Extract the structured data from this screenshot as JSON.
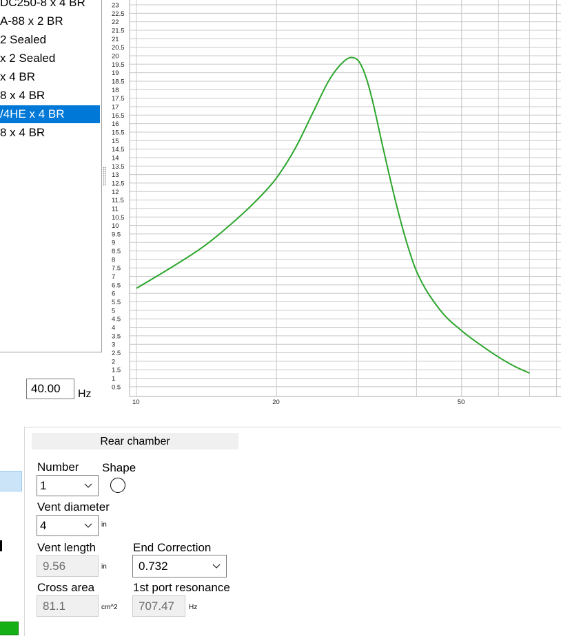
{
  "designs": {
    "items": [
      {
        "label": "DC250-8 x 4 BR",
        "selected": false
      },
      {
        "label": "A-88 x 2 BR",
        "selected": false
      },
      {
        "label": "2 Sealed",
        "selected": false
      },
      {
        "label": "x 2 Sealed",
        "selected": false
      },
      {
        "label": "x 4 BR",
        "selected": false
      },
      {
        "label": "8 x 4 BR",
        "selected": false
      },
      {
        "label": "/4HE x 4 BR",
        "selected": true
      },
      {
        "label": "8 x 4 BR",
        "selected": false
      }
    ]
  },
  "frequency": {
    "value": "40.00",
    "unit": "Hz"
  },
  "rear_chamber": {
    "title": "Rear chamber",
    "number_label": "Number",
    "number_value": "1",
    "shape_label": "Shape",
    "shape_icon": "circle-icon",
    "vent_diameter_label": "Vent diameter",
    "vent_diameter_value": "4",
    "vent_diameter_unit": "in",
    "vent_length_label": "Vent length",
    "vent_length_value": "9.56",
    "vent_length_unit": "in",
    "end_correction_label": "End Correction",
    "end_correction_value": "0.732",
    "cross_area_label": "Cross area",
    "cross_area_value": "81.1",
    "cross_area_unit": "cm^2",
    "port_resonance_label": "1st port resonance",
    "port_resonance_value": "707.47",
    "port_resonance_unit": "Hz"
  },
  "chart_data": {
    "type": "line",
    "x_scale": "log",
    "y_ticks": [
      "23",
      "22.5",
      "22",
      "21.5",
      "21",
      "20.5",
      "20",
      "19.5",
      "19",
      "18.5",
      "18",
      "17.5",
      "17",
      "16.5",
      "16",
      "15.5",
      "15",
      "14.5",
      "14",
      "13.5",
      "13",
      "12.5",
      "12",
      "11.5",
      "11",
      "10.5",
      "10",
      "9.5",
      "9",
      "8.5",
      "8",
      "7.5",
      "7",
      "6.5",
      "6",
      "5.5",
      "5",
      "4.5",
      "4",
      "3.5",
      "3",
      "2.5",
      "2",
      "1.5",
      "1",
      "0.5"
    ],
    "x_tick_labels": [
      "10",
      "20",
      "50"
    ],
    "grid": true,
    "line_color": "#2aa52a",
    "series": [
      {
        "x": [
          10,
          12,
          14,
          16,
          18,
          20,
          22,
          24,
          26,
          28,
          29,
          30,
          31,
          32,
          34,
          36,
          38,
          40,
          45,
          50,
          55,
          60,
          65,
          70
        ],
        "y": [
          6.3,
          7.6,
          8.8,
          10.1,
          11.4,
          12.8,
          14.6,
          16.7,
          18.6,
          19.7,
          19.9,
          19.7,
          18.9,
          17.6,
          14.4,
          11.5,
          9.1,
          7.3,
          5.0,
          3.8,
          2.95,
          2.25,
          1.7,
          1.3
        ]
      }
    ]
  }
}
